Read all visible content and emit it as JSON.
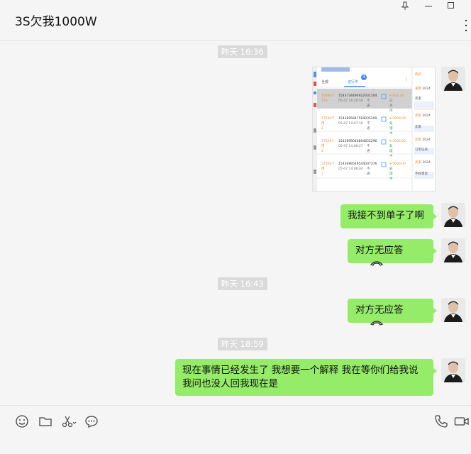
{
  "window": {
    "title": "3S欠我1000W",
    "pin_icon": "pin-icon",
    "minimize_icon": "minimize-icon",
    "maximize_icon": "maximize-icon",
    "more_icon": "more-icon"
  },
  "messages": [
    {
      "type": "timestamp",
      "text": "昨天 16:36"
    },
    {
      "type": "image",
      "sender": "self"
    },
    {
      "type": "text",
      "sender": "self",
      "text": "我接不到单子了啊"
    },
    {
      "type": "call",
      "sender": "self",
      "text": "对方无应答"
    },
    {
      "type": "timestamp",
      "text": "昨天 16:43"
    },
    {
      "type": "call",
      "sender": "self",
      "text": "对方无应答"
    },
    {
      "type": "timestamp",
      "text": "昨天 18:59"
    },
    {
      "type": "text",
      "sender": "self",
      "lines": [
        "现在事情已经发生了 我想要一个解释 我在等你们给我说",
        "我问也没人回我现在是"
      ]
    }
  ],
  "screenshot": {
    "tabs": [
      "全部",
      "进行中"
    ],
    "badge": "4",
    "side_labels": [
      "购买",
      "来稿",
      "卖家",
      "卖家",
      "卖家",
      "卖家",
      "订单已关",
      "卖家",
      "不好意思"
    ],
    "year": "2024",
    "orders": [
      {
        "qty": "10000个",
        "code": "156",
        "id": "1543734494922031104",
        "date": "05-07 16:26:58",
        "tag": "不通",
        "price": "¥ 833.33",
        "status": "已关闭"
      },
      {
        "qty": "57500个",
        "code": "用2",
        "id": "1543695847594035200",
        "date": "05-07 14:07:16",
        "tag": "不通",
        "price": "¥ 5000.00",
        "status": "处理中"
      },
      {
        "qty": "57500个",
        "code": "用2",
        "id": "1543699046804655296",
        "date": "05-07 14:08:27",
        "tag": "不通",
        "price": "¥ 5000.00",
        "status": "处理中"
      },
      {
        "qty": "57500个",
        "code": "用2",
        "id": "1543699549544037376",
        "date": "05-07 14:08:04",
        "tag": "不通",
        "price": "¥ 5000.00",
        "status": "处理中"
      }
    ]
  },
  "toolbar": {
    "left": [
      "emoji-icon",
      "folder-icon",
      "scissors-icon",
      "chat-bubble-icon"
    ],
    "right": [
      "phone-icon",
      "video-icon"
    ]
  },
  "colors": {
    "bubble": "#95ec69",
    "background": "#f5f5f5",
    "timestamp_bg": "#dadada"
  }
}
